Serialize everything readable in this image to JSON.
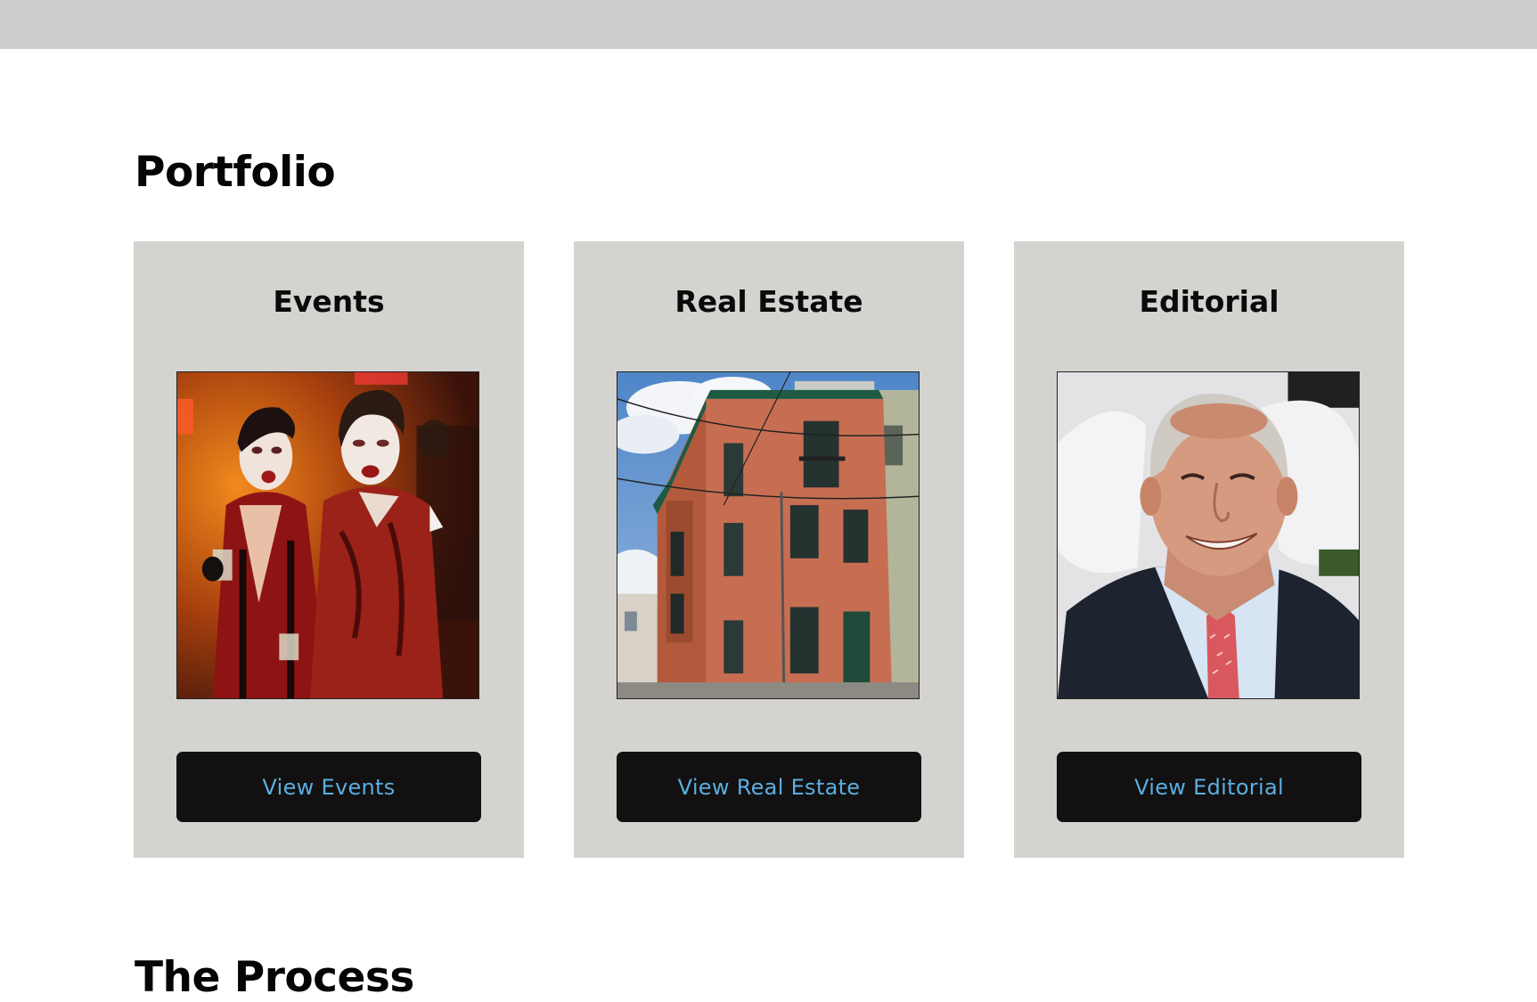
{
  "portfolio": {
    "title": "Portfolio",
    "cards": [
      {
        "title": "Events",
        "button_label": "View Events",
        "image": "vampire-costume-party-photo"
      },
      {
        "title": "Real Estate",
        "button_label": "View Real Estate",
        "image": "brick-townhouse-photo"
      },
      {
        "title": "Editorial",
        "button_label": "View Editorial",
        "image": "smiling-man-portrait-photo"
      }
    ]
  },
  "process": {
    "title": "The Process"
  },
  "colors": {
    "top_bar": "#cccccc",
    "card_background": "#d4d3d0",
    "button_background": "#121010",
    "button_text": "#5aaee0"
  }
}
